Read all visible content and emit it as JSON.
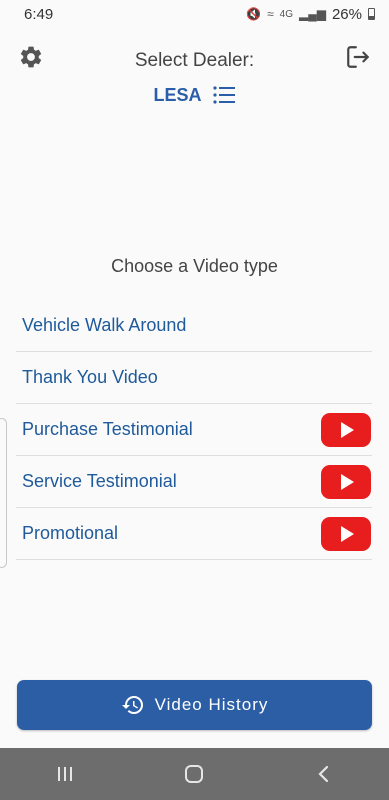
{
  "status_bar": {
    "time": "6:49",
    "network": "4G",
    "battery": "26%"
  },
  "header": {
    "title": "Select Dealer:",
    "dealer_name": "LESA"
  },
  "main": {
    "prompt": "Choose a Video type",
    "video_types": [
      {
        "label": "Vehicle Walk Around",
        "youtube": false
      },
      {
        "label": "Thank You Video",
        "youtube": false
      },
      {
        "label": "Purchase Testimonial",
        "youtube": true
      },
      {
        "label": "Service Testimonial",
        "youtube": true
      },
      {
        "label": "Promotional",
        "youtube": true
      }
    ]
  },
  "footer": {
    "history_label": "Video History"
  },
  "colors": {
    "accent": "#2c5ea6",
    "link_text": "#1f5a9a",
    "youtube_red": "#e81e1e",
    "nav_bar": "#6d6d6d"
  },
  "icons": [
    "settings-icon",
    "logout-icon",
    "list-icon",
    "youtube-icon",
    "history-icon",
    "recents-icon",
    "home-icon",
    "back-icon"
  ]
}
